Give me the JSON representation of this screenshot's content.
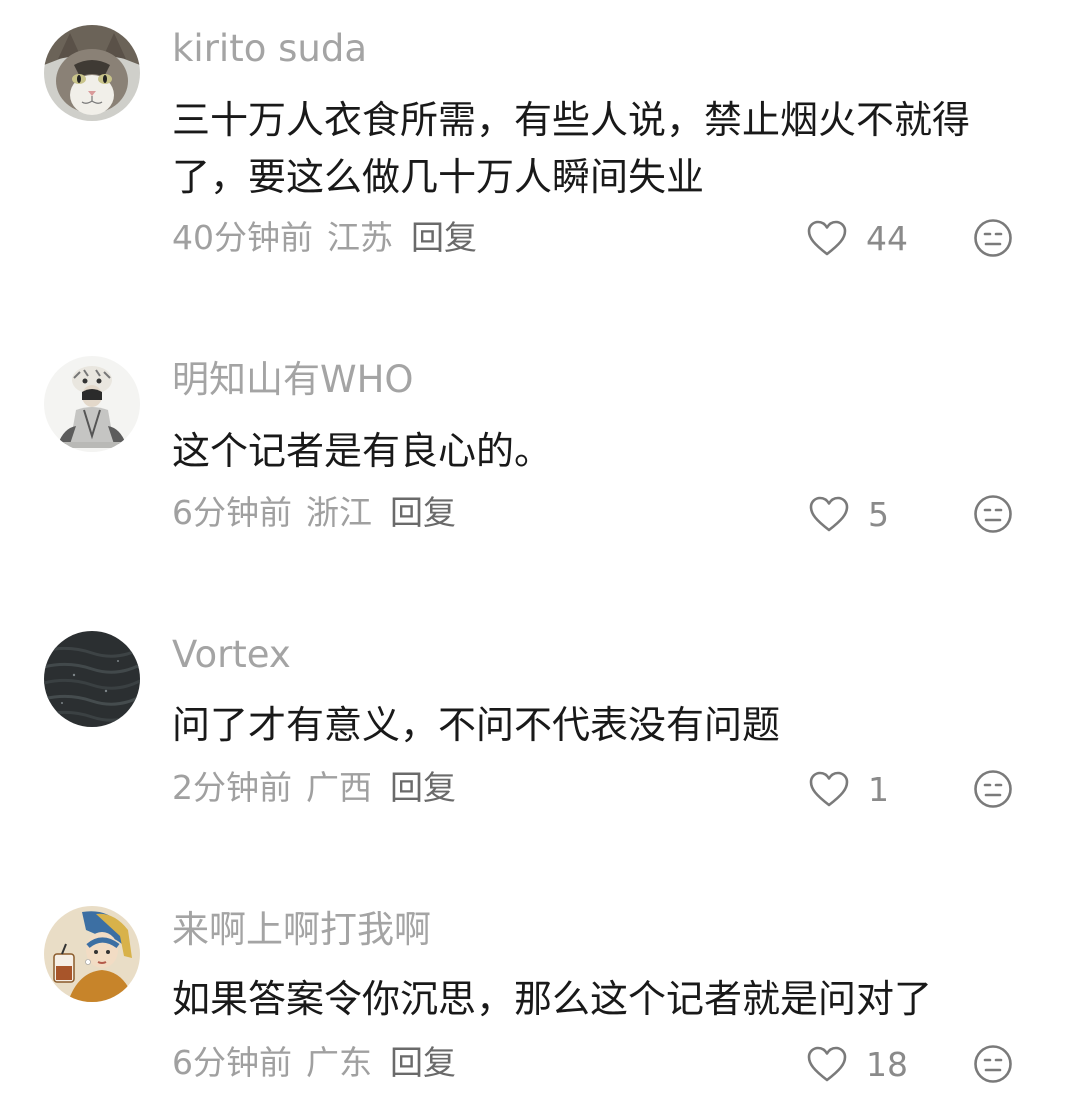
{
  "comments": [
    {
      "username": "kirito suda",
      "content": "三十万人衣食所需，有些人说，禁止烟火不就得了，要这么做几十万人瞬间失业",
      "time": "40分钟前",
      "location": "江苏",
      "reply": "回复",
      "likes": "44",
      "avatar_icon": "cat-avatar"
    },
    {
      "username": "明知山有WHO",
      "content": "这个记者是有良心的。",
      "time": "6分钟前",
      "location": "浙江",
      "reply": "回复",
      "likes": "5",
      "avatar_icon": "tiger-person-avatar"
    },
    {
      "username": "Vortex",
      "content": "问了才有意义，不问不代表没有问题",
      "time": "2分钟前",
      "location": "广西",
      "reply": "回复",
      "likes": "1",
      "avatar_icon": "dark-water-avatar"
    },
    {
      "username": "来啊上啊打我啊",
      "content": "如果答案令你沉思，那么这个记者就是问对了",
      "time": "6分钟前",
      "location": "广东",
      "reply": "回复",
      "likes": "18",
      "avatar_icon": "girl-pearl-earring-avatar"
    }
  ],
  "icons": {
    "like": "heart-outline-icon",
    "dislike": "meh-face-icon"
  },
  "colors": {
    "username": "#a4a4a4",
    "content": "#191919",
    "meta": "#a0a0a0",
    "icon": "#7a7a7a"
  }
}
